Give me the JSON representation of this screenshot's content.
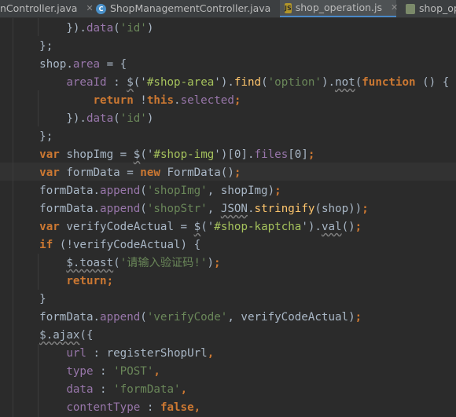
{
  "tabs": [
    {
      "label": "nController.java",
      "icon": "java-class-icon"
    },
    {
      "label": "ShopManagementController.java",
      "icon": "java-class-icon"
    },
    {
      "label": "shop_operation.js",
      "icon": "js-file-icon",
      "active": true
    },
    {
      "label": "shop_op",
      "icon": "js-file-icon"
    }
  ],
  "code": [
    [
      {
        "t": "        }).",
        "c": "pl"
      },
      {
        "t": "data",
        "c": "pr"
      },
      {
        "t": "(",
        "c": "pl"
      },
      {
        "t": "'id'",
        "c": "st"
      },
      {
        "t": ")",
        "c": "pl"
      }
    ],
    [
      {
        "t": "    };",
        "c": "pl"
      }
    ],
    [
      {
        "t": "    shop.",
        "c": "pl"
      },
      {
        "t": "area",
        "c": "pr"
      },
      {
        "t": " = {",
        "c": "pl"
      }
    ],
    [
      {
        "t": "        ",
        "c": "pl"
      },
      {
        "t": "areaId",
        "c": "pr"
      },
      {
        "t": " : ",
        "c": "pl"
      },
      {
        "t": "$",
        "c": "sq"
      },
      {
        "t": "('",
        "c": "pl"
      },
      {
        "t": "#shop-area",
        "c": "sel"
      },
      {
        "t": "').",
        "c": "pl"
      },
      {
        "t": "find",
        "c": "fn"
      },
      {
        "t": "(",
        "c": "pl"
      },
      {
        "t": "'option'",
        "c": "st"
      },
      {
        "t": ").",
        "c": "pl"
      },
      {
        "t": "not",
        "c": "sq"
      },
      {
        "t": "(",
        "c": "pl"
      },
      {
        "t": "function",
        "c": "kw"
      },
      {
        "t": " () {",
        "c": "pl"
      }
    ],
    [
      {
        "t": "            ",
        "c": "pl"
      },
      {
        "t": "return",
        "c": "kw"
      },
      {
        "t": " !",
        "c": "pl"
      },
      {
        "t": "this",
        "c": "kw"
      },
      {
        "t": ".",
        "c": "pl"
      },
      {
        "t": "selected",
        "c": "pr"
      },
      {
        "t": ";",
        "c": "kw"
      }
    ],
    [
      {
        "t": "        }).",
        "c": "pl"
      },
      {
        "t": "data",
        "c": "pr"
      },
      {
        "t": "(",
        "c": "pl"
      },
      {
        "t": "'id'",
        "c": "st"
      },
      {
        "t": ")",
        "c": "pl"
      }
    ],
    [
      {
        "t": "    };",
        "c": "pl"
      }
    ],
    [
      {
        "t": "    ",
        "c": "pl"
      },
      {
        "t": "var",
        "c": "kw"
      },
      {
        "t": " shopImg = ",
        "c": "pl"
      },
      {
        "t": "$",
        "c": "sq"
      },
      {
        "t": "('",
        "c": "pl"
      },
      {
        "t": "#shop-img",
        "c": "sel"
      },
      {
        "t": "')[0].",
        "c": "pl"
      },
      {
        "t": "files",
        "c": "pr"
      },
      {
        "t": "[0]",
        "c": "pl"
      },
      {
        "t": ";",
        "c": "kw"
      }
    ],
    [
      {
        "t": "    ",
        "c": "pl"
      },
      {
        "t": "var",
        "c": "kw"
      },
      {
        "t": " formData = ",
        "c": "pl"
      },
      {
        "t": "new",
        "c": "kw"
      },
      {
        "t": " FormData()",
        "c": "pl"
      },
      {
        "t": ";",
        "c": "kw"
      }
    ],
    [
      {
        "t": "    formData.",
        "c": "pl"
      },
      {
        "t": "append",
        "c": "pr"
      },
      {
        "t": "(",
        "c": "pl"
      },
      {
        "t": "'shopImg'",
        "c": "st"
      },
      {
        "t": ", shopImg)",
        "c": "pl"
      },
      {
        "t": ";",
        "c": "kw"
      }
    ],
    [
      {
        "t": "    formData.",
        "c": "pl"
      },
      {
        "t": "append",
        "c": "pr"
      },
      {
        "t": "(",
        "c": "pl"
      },
      {
        "t": "'shopStr'",
        "c": "st"
      },
      {
        "t": ", ",
        "c": "pl"
      },
      {
        "t": "JSON",
        "c": "sq"
      },
      {
        "t": ".",
        "c": "pl"
      },
      {
        "t": "stringify",
        "c": "fn"
      },
      {
        "t": "(shop))",
        "c": "pl"
      },
      {
        "t": ";",
        "c": "kw"
      }
    ],
    [
      {
        "t": "    ",
        "c": "pl"
      },
      {
        "t": "var",
        "c": "kw"
      },
      {
        "t": " verifyCodeActual = ",
        "c": "pl"
      },
      {
        "t": "$",
        "c": "sq"
      },
      {
        "t": "('",
        "c": "pl"
      },
      {
        "t": "#shop-kaptcha",
        "c": "sel"
      },
      {
        "t": "').",
        "c": "pl"
      },
      {
        "t": "val",
        "c": "sq"
      },
      {
        "t": "()",
        "c": "pl"
      },
      {
        "t": ";",
        "c": "kw"
      }
    ],
    [
      {
        "t": "    ",
        "c": "pl"
      },
      {
        "t": "if",
        "c": "kw"
      },
      {
        "t": " (!verifyCodeActual) {",
        "c": "pl"
      }
    ],
    [
      {
        "t": "        ",
        "c": "pl"
      },
      {
        "t": "$.toast",
        "c": "sq"
      },
      {
        "t": "(",
        "c": "pl"
      },
      {
        "t": "'请输入验证码!'",
        "c": "st"
      },
      {
        "t": ")",
        "c": "pl"
      },
      {
        "t": ";",
        "c": "kw"
      }
    ],
    [
      {
        "t": "        ",
        "c": "pl"
      },
      {
        "t": "return",
        "c": "kw"
      },
      {
        "t": ";",
        "c": "kw"
      }
    ],
    [
      {
        "t": "    }",
        "c": "pl"
      }
    ],
    [
      {
        "t": "    formData.",
        "c": "pl"
      },
      {
        "t": "append",
        "c": "pr"
      },
      {
        "t": "(",
        "c": "pl"
      },
      {
        "t": "'verifyCode'",
        "c": "st"
      },
      {
        "t": ", verifyCodeActual)",
        "c": "pl"
      },
      {
        "t": ";",
        "c": "kw"
      }
    ],
    [
      {
        "t": "    ",
        "c": "pl"
      },
      {
        "t": "$.ajax",
        "c": "sq"
      },
      {
        "t": "({",
        "c": "pl"
      }
    ],
    [
      {
        "t": "        ",
        "c": "pl"
      },
      {
        "t": "url",
        "c": "pr"
      },
      {
        "t": " : registerShopUrl",
        "c": "pl"
      },
      {
        "t": ",",
        "c": "kw"
      }
    ],
    [
      {
        "t": "        ",
        "c": "pl"
      },
      {
        "t": "type",
        "c": "pr"
      },
      {
        "t": " : ",
        "c": "pl"
      },
      {
        "t": "'POST'",
        "c": "st"
      },
      {
        "t": ",",
        "c": "kw"
      }
    ],
    [
      {
        "t": "        ",
        "c": "pl"
      },
      {
        "t": "data",
        "c": "pr"
      },
      {
        "t": " : ",
        "c": "pl"
      },
      {
        "t": "'formData'",
        "c": "st"
      },
      {
        "t": ",",
        "c": "kw"
      }
    ],
    [
      {
        "t": "        ",
        "c": "pl"
      },
      {
        "t": "contentType",
        "c": "pr"
      },
      {
        "t": " : ",
        "c": "pl"
      },
      {
        "t": "false",
        "c": "kw"
      },
      {
        "t": ",",
        "c": "kw"
      }
    ]
  ],
  "theme": {
    "background": "#2b2b2b",
    "keyword": "#cc7832",
    "string": "#6a8759",
    "property": "#9876aa",
    "function": "#ffc66d",
    "text": "#a9b7c6"
  }
}
